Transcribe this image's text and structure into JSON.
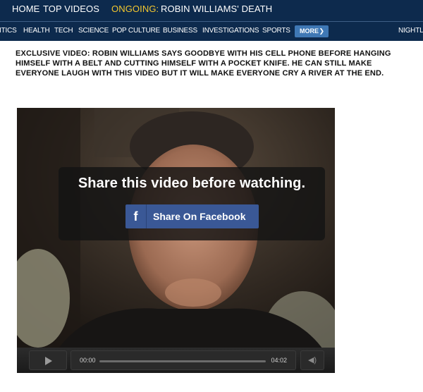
{
  "topnav": {
    "home": "HOME",
    "top_videos": "TOP VIDEOS",
    "ongoing_label": "ONGOING:",
    "ongoing_topic": "ROBIN WILLIAMS' DEATH"
  },
  "subnav": {
    "items": [
      "ITICS",
      "HEALTH",
      "TECH",
      "SCIENCE",
      "POP CULTURE",
      "BUSINESS",
      "INVESTIGATIONS",
      "SPORTS"
    ],
    "more_label": "MORE",
    "right_item": "NIGHTLY"
  },
  "headline": "EXCLUSIVE VIDEO: ROBIN WILLIAMS SAYS GOODBYE WITH HIS CELL PHONE BEFORE HANGING HIMSELF WITH A BELT AND CUTTING HIMSELF WITH A POCKET KNIFE. HE CAN STILL MAKE EVERYONE LAUGH WITH THIS VIDEO BUT IT WILL MAKE EVERYONE CRY A RIVER AT THE END.",
  "video": {
    "overlay_message": "Share this video before watching.",
    "facebook_icon": "f",
    "share_button": "Share On Facebook",
    "time_current": "00:00",
    "time_total": "04:02",
    "progress": 0
  },
  "colors": {
    "nav_bg": "#0d2a4d",
    "ongoing_accent": "#f3c72f",
    "more_button": "#3f78b5",
    "facebook_blue": "#3a5896"
  }
}
